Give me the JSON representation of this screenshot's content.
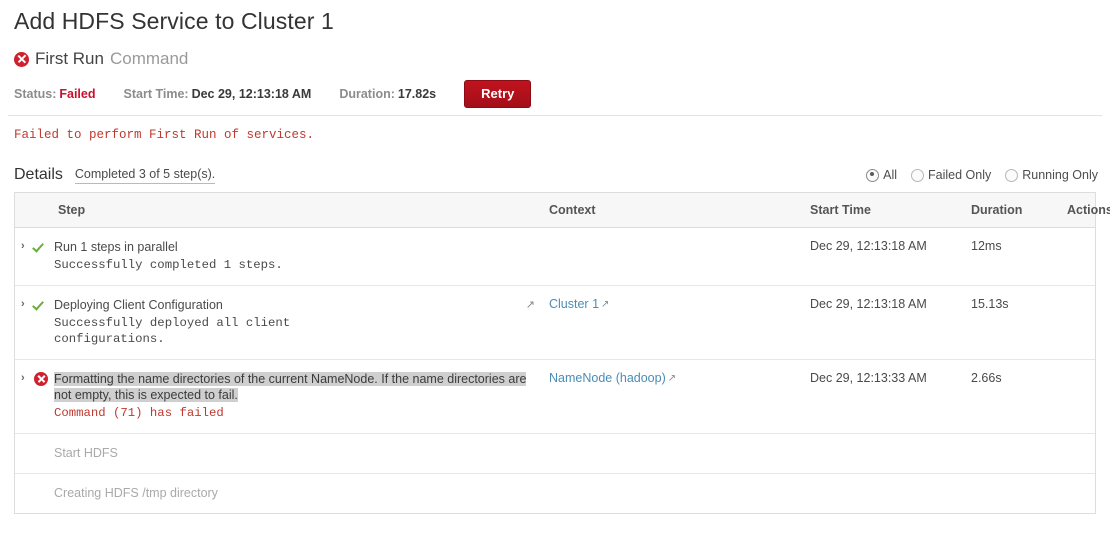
{
  "header": {
    "title": "Add HDFS Service to Cluster 1",
    "command_icon": "error-circle-icon",
    "command_name": "First Run",
    "command_suffix": "Command"
  },
  "status": {
    "status_label": "Status:",
    "status_value": "Failed",
    "start_time_label": "Start Time:",
    "start_time_value": "Dec 29, 12:13:18 AM",
    "duration_label": "Duration:",
    "duration_value": "17.82s",
    "retry_label": "Retry",
    "fail_color": "#c8102e",
    "retry_bg": "#b5101b"
  },
  "error_message": "Failed to perform First Run of services.",
  "details": {
    "label": "Details",
    "progress_link": "Completed 3 of 5 step(s).",
    "filters": [
      {
        "label": "All",
        "checked": true
      },
      {
        "label": "Failed Only",
        "checked": false
      },
      {
        "label": "Running Only",
        "checked": false
      }
    ]
  },
  "table": {
    "columns": {
      "step": "Step",
      "context": "Context",
      "start_time": "Start Time",
      "duration": "Duration",
      "actions": "Actions"
    },
    "rows": [
      {
        "expander": "›",
        "state": "success",
        "state_icon": "green-check-icon",
        "title": "Run 1 steps in parallel",
        "title_selected": false,
        "description": "Successfully completed 1 steps.",
        "description_error": false,
        "step_trailing_icon": "",
        "context": "",
        "context_icon": "",
        "start_time": "Dec 29, 12:13:18 AM",
        "duration": "12ms",
        "actions": ""
      },
      {
        "expander": "›",
        "state": "success",
        "state_icon": "green-check-icon",
        "title": "Deploying Client Configuration",
        "title_selected": false,
        "description": "Successfully deployed all client\nconfigurations.",
        "description_error": false,
        "step_trailing_icon": "↗",
        "context": "Cluster 1",
        "context_icon": "↗",
        "start_time": "Dec 29, 12:13:18 AM",
        "duration": "15.13s",
        "actions": ""
      },
      {
        "expander": "›",
        "state": "failed",
        "state_icon": "error-circle-icon",
        "title": "Formatting the name directories of the current NameNode. If the name directories are not empty, this is expected to fail.",
        "title_selected": true,
        "description": "Command (71) has failed",
        "description_error": true,
        "step_trailing_icon": "",
        "context": "NameNode (hadoop)",
        "context_icon": "↗",
        "start_time": "Dec 29, 12:13:33 AM",
        "duration": "2.66s",
        "actions": ""
      },
      {
        "expander": "",
        "state": "pending",
        "state_icon": "",
        "title": "Start HDFS",
        "title_selected": false,
        "description": "",
        "description_error": false,
        "step_trailing_icon": "",
        "context": "",
        "context_icon": "",
        "start_time": "",
        "duration": "",
        "actions": ""
      },
      {
        "expander": "",
        "state": "pending",
        "state_icon": "",
        "title": "Creating HDFS /tmp directory",
        "title_selected": false,
        "description": "",
        "description_error": false,
        "step_trailing_icon": "",
        "context": "",
        "context_icon": "",
        "start_time": "",
        "duration": "",
        "actions": ""
      }
    ]
  }
}
